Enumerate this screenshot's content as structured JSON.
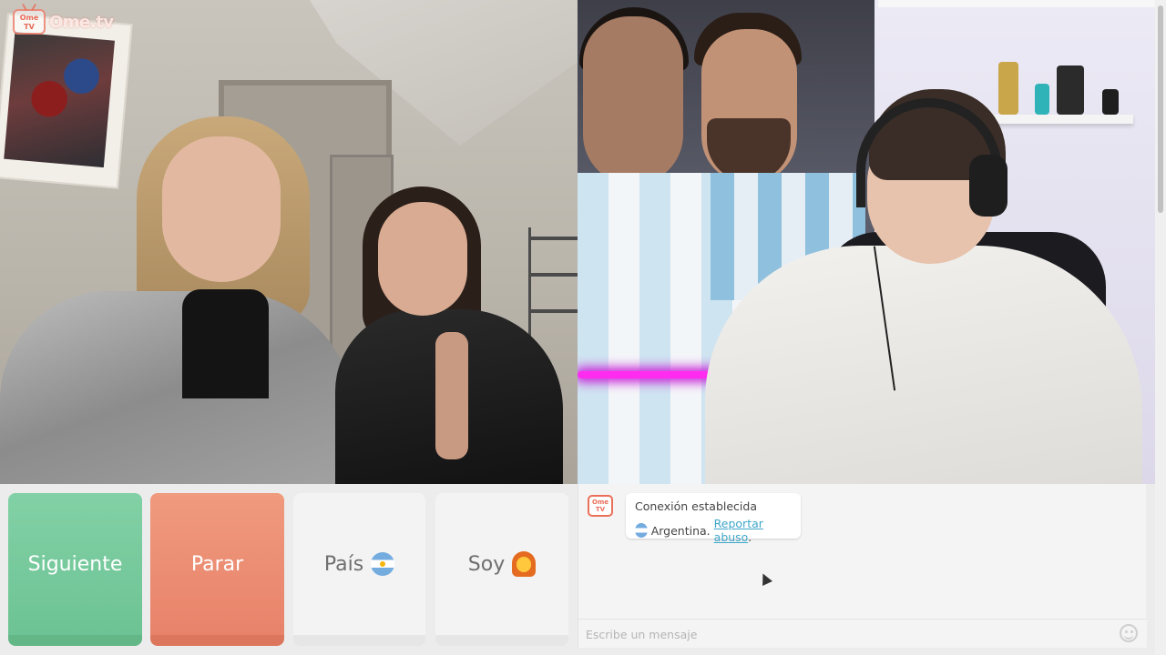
{
  "app": {
    "logo_text": "Ome.tv",
    "logo_badge": "Ome TV"
  },
  "controls": {
    "next_label": "Siguiente",
    "stop_label": "Parar",
    "country_label": "País",
    "country_flag_icon": "argentina-flag-icon",
    "gender_label": "Soy",
    "gender_icon": "girl-emoji-icon"
  },
  "chat": {
    "avatar_label": "Ome TV",
    "message_line1": "Conexión establecida",
    "country_name": "Argentina.",
    "report_link": "Reportar abuso",
    "report_suffix": ".",
    "input_placeholder": "Escribe un mensaje",
    "input_value": ""
  },
  "colors": {
    "next": "#6dc394",
    "stop": "#e8836a",
    "link": "#3ea6c9",
    "brand": "#ea6f59"
  }
}
